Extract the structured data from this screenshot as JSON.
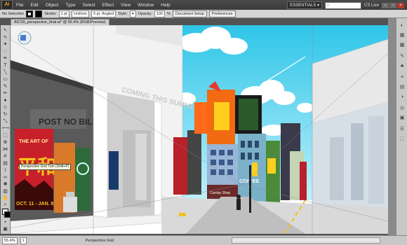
{
  "app": {
    "logo": "Ai"
  },
  "menu": [
    "File",
    "Edit",
    "Object",
    "Type",
    "Select",
    "Effect",
    "View",
    "Window",
    "Help"
  ],
  "workspace": "ESSENTIALS ▾",
  "cs_live": "CS Live",
  "control_bar": {
    "selection_label": "No Selection",
    "stroke_label": "Stroke:",
    "stroke_value": "1 pt",
    "profile_value": "Uniform",
    "brush_value": "5 pt. Angled",
    "style_label": "Style:",
    "opacity_label": "Opacity:",
    "opacity_value": "100",
    "opacity_unit": "%",
    "doc_setup_label": "Document Setup",
    "preferences_label": "Preferences"
  },
  "document_tab": "AICS5_perspective_final.ai* @ 55.4% (RGB/Preview)",
  "tooltip": "Perspective Grid Tool (Shift+P)",
  "artwork": {
    "wall_text": "COMING THIS SUMMER",
    "post_no_bills": "POST NO BILLS",
    "poster_title": "THE ART OF",
    "poster_chars": "平和",
    "poster_dates": "OCT. 11 - JAN. 8",
    "coffee_sign": "COFFEE",
    "shop_sign": "Corday Shop"
  },
  "status_bar": {
    "zoom": "55.4%",
    "page": "1",
    "tool_name": "Perspective Grid"
  }
}
